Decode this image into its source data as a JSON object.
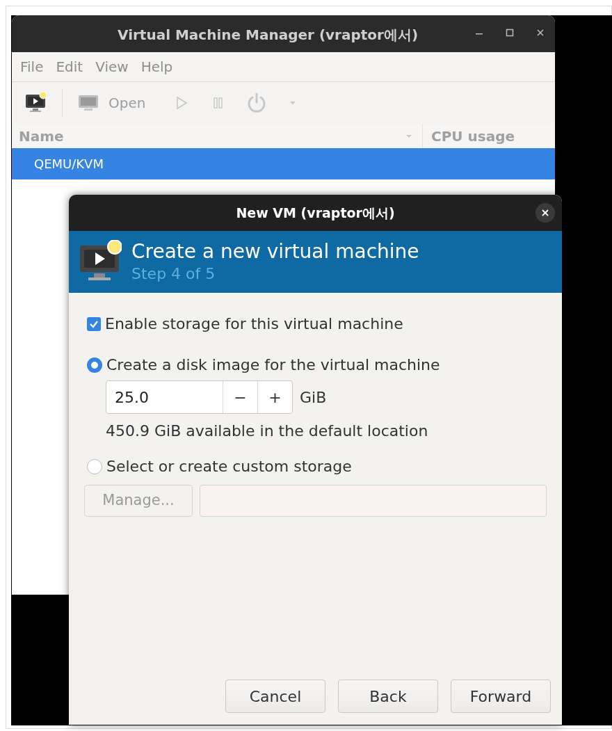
{
  "main_window": {
    "title": "Virtual Machine Manager (vraptor에서)",
    "menu": [
      "File",
      "Edit",
      "View",
      "Help"
    ],
    "toolbar": {
      "open_label": "Open"
    },
    "table": {
      "columns": [
        "Name",
        "CPU usage"
      ],
      "rows": [
        {
          "name": "QEMU/KVM",
          "selected": true
        }
      ]
    }
  },
  "dialog": {
    "title": "New VM (vraptor에서)",
    "header": {
      "title": "Create a new virtual machine",
      "subtitle": "Step 4 of 5"
    },
    "enable_storage": {
      "label": "Enable storage for this virtual machine",
      "checked": true
    },
    "options": [
      {
        "label": "Create a disk image for the virtual machine",
        "selected": true
      },
      {
        "label": "Select or create custom storage",
        "selected": false
      }
    ],
    "size": {
      "value": "25.0",
      "minus": "−",
      "plus": "+",
      "unit": "GiB"
    },
    "available": "450.9 GiB available in the default location",
    "manage_button": "Manage...",
    "buttons": [
      "Cancel",
      "Back",
      "Forward"
    ]
  }
}
